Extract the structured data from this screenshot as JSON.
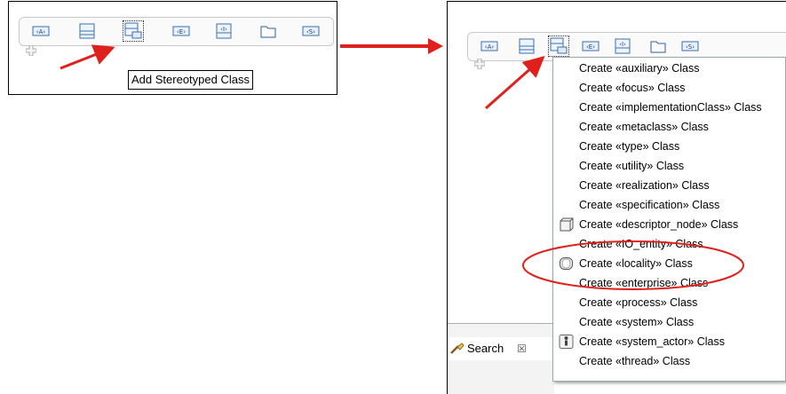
{
  "tooltip": {
    "text": "Add Stereotyped Class"
  },
  "search_tab": {
    "label": "Search",
    "close_glyph": "☒"
  },
  "palette": {
    "tools": [
      {
        "name": "tool-attribute",
        "icon": "attribute-icon",
        "glyph": "‹A›"
      },
      {
        "name": "tool-class",
        "icon": "class-icon",
        "glyph": ""
      },
      {
        "name": "tool-stereotyped-class",
        "icon": "stereotyped-class-icon",
        "glyph": ""
      },
      {
        "name": "tool-enumeration",
        "icon": "enumeration-icon",
        "glyph": "‹E›"
      },
      {
        "name": "tool-interface",
        "icon": "interface-icon",
        "glyph": "‹I›"
      },
      {
        "name": "tool-package",
        "icon": "folder-icon",
        "glyph": ""
      },
      {
        "name": "tool-signal",
        "icon": "signal-icon",
        "glyph": "‹S›"
      }
    ]
  },
  "menu": {
    "items": [
      {
        "label": "Create «auxiliary» Class",
        "icon": ""
      },
      {
        "label": "Create «focus» Class",
        "icon": ""
      },
      {
        "label": "Create «implementationClass» Class",
        "icon": ""
      },
      {
        "label": "Create «metaclass» Class",
        "icon": ""
      },
      {
        "label": "Create «type» Class",
        "icon": ""
      },
      {
        "label": "Create «utility» Class",
        "icon": ""
      },
      {
        "label": "Create «realization» Class",
        "icon": ""
      },
      {
        "label": "Create «specification» Class",
        "icon": ""
      },
      {
        "label": "Create «descriptor_node» Class",
        "icon": "cube-icon"
      },
      {
        "label": "Create «IO_entity» Class",
        "icon": ""
      },
      {
        "label": "Create «locality» Class",
        "icon": "rounded-box-icon"
      },
      {
        "label": "Create «enterprise» Class",
        "icon": ""
      },
      {
        "label": "Create «process» Class",
        "icon": ""
      },
      {
        "label": "Create «system» Class",
        "icon": ""
      },
      {
        "label": "Create «system_actor» Class",
        "icon": "actor-icon"
      },
      {
        "label": "Create «thread» Class",
        "icon": ""
      }
    ]
  },
  "colors": {
    "arrow": "#e0201c",
    "highlight_ellipse": "#e0201c",
    "icon_blue": "#3a6fb0"
  }
}
